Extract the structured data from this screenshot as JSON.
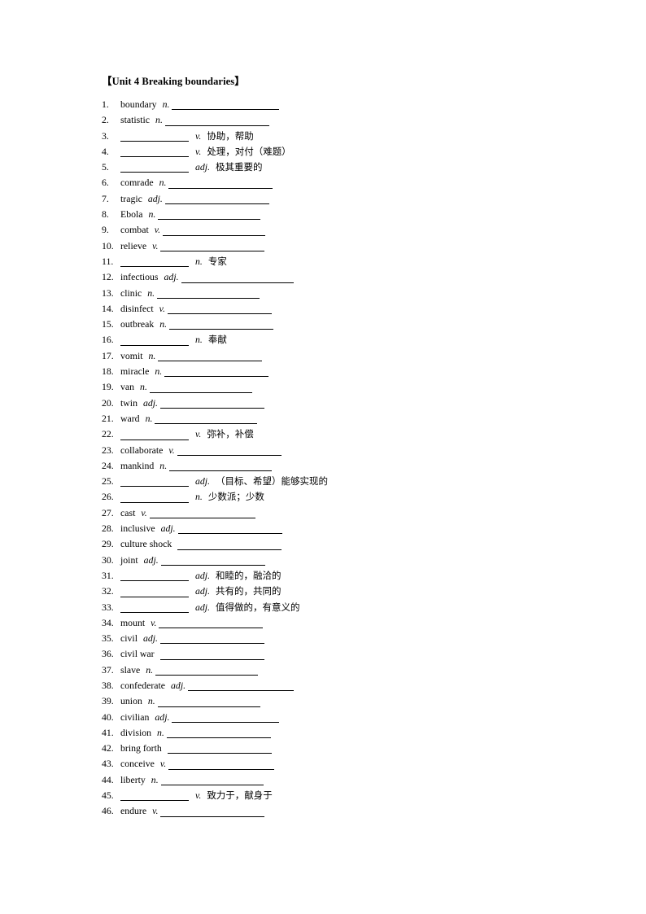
{
  "document": {
    "title": "【Unit 4 Breaking boundaries】",
    "title_bracket_open": "【",
    "title_bracket_close": "】",
    "title_text": "Unit 4 Breaking boundaries"
  },
  "vocabulary": {
    "columns": [
      "number",
      "term",
      "part_of_speech",
      "answer_blank",
      "meaning"
    ],
    "items": [
      {
        "num": "1.",
        "term": "boundary",
        "pos": "n.",
        "meaning": "",
        "blank_width": 132
      },
      {
        "num": "2.",
        "term": "statistic",
        "pos": "n.",
        "meaning": "",
        "blank_width": 128
      },
      {
        "num": "3.",
        "term": "",
        "pos": "v.",
        "meaning": "协助，帮助",
        "blank_width": 84
      },
      {
        "num": "4.",
        "term": "",
        "pos": "v.",
        "meaning": "处理，对付（难题）",
        "blank_width": 84
      },
      {
        "num": "5.",
        "term": "",
        "pos": "adj.",
        "meaning": "极其重要的",
        "blank_width": 84
      },
      {
        "num": "6.",
        "term": "comrade",
        "pos": "n.",
        "meaning": "",
        "blank_width": 128
      },
      {
        "num": "7.",
        "term": "tragic",
        "pos": "adj.",
        "meaning": "",
        "blank_width": 128
      },
      {
        "num": "8.",
        "term": "Ebola",
        "pos": "n.",
        "meaning": "",
        "blank_width": 126
      },
      {
        "num": "9.",
        "term": "combat",
        "pos": "v.",
        "meaning": "",
        "blank_width": 126
      },
      {
        "num": "10.",
        "term": "relieve",
        "pos": "v.",
        "meaning": "",
        "blank_width": 128
      },
      {
        "num": "11.",
        "term": "",
        "pos": "n.",
        "meaning": "专家",
        "blank_width": 84
      },
      {
        "num": "12.",
        "term": "infectious",
        "pos": "adj.",
        "meaning": "",
        "blank_width": 138
      },
      {
        "num": "13.",
        "term": "clinic",
        "pos": "n.",
        "meaning": "",
        "blank_width": 126
      },
      {
        "num": "14.",
        "term": "disinfect",
        "pos": "v.",
        "meaning": "",
        "blank_width": 128
      },
      {
        "num": "15.",
        "term": "outbreak",
        "pos": "n.",
        "meaning": "",
        "blank_width": 128
      },
      {
        "num": "16.",
        "term": "",
        "pos": "n.",
        "meaning": "奉献",
        "blank_width": 84
      },
      {
        "num": "17.",
        "term": "vomit",
        "pos": "n.",
        "meaning": "",
        "blank_width": 128
      },
      {
        "num": "18.",
        "term": "miracle",
        "pos": "n.",
        "meaning": "",
        "blank_width": 128
      },
      {
        "num": "19.",
        "term": "van",
        "pos": "n.",
        "meaning": "",
        "blank_width": 126
      },
      {
        "num": "20.",
        "term": "twin",
        "pos": "adj.",
        "meaning": "",
        "blank_width": 128
      },
      {
        "num": "21.",
        "term": "ward",
        "pos": "n.",
        "meaning": "",
        "blank_width": 126
      },
      {
        "num": "22.",
        "term": "",
        "pos": "v.",
        "meaning": "弥补，补偿",
        "blank_width": 84
      },
      {
        "num": "23.",
        "term": "collaborate",
        "pos": "v.",
        "meaning": "",
        "blank_width": 128
      },
      {
        "num": "24.",
        "term": "mankind",
        "pos": "n.",
        "meaning": "",
        "blank_width": 126
      },
      {
        "num": "25.",
        "term": "",
        "pos": "adj.",
        "meaning": "（目标、希望）能够实现的",
        "blank_width": 84
      },
      {
        "num": "26.",
        "term": "",
        "pos": "n.",
        "meaning": "少数派；少数",
        "blank_width": 84
      },
      {
        "num": "27.",
        "term": "cast",
        "pos": "v.",
        "meaning": "",
        "blank_width": 130
      },
      {
        "num": "28.",
        "term": "inclusive",
        "pos": "adj.",
        "meaning": "",
        "blank_width": 128
      },
      {
        "num": "29.",
        "term": "culture shock",
        "pos": "",
        "meaning": "",
        "blank_width": 128
      },
      {
        "num": "30.",
        "term": "joint",
        "pos": "adj.",
        "meaning": "",
        "blank_width": 128
      },
      {
        "num": "31.",
        "term": "",
        "pos": "adj.",
        "meaning": "和睦的，融洽的",
        "blank_width": 84
      },
      {
        "num": "32.",
        "term": "",
        "pos": "adj.",
        "meaning": "共有的，共同的",
        "blank_width": 84
      },
      {
        "num": "33.",
        "term": "",
        "pos": "adj.",
        "meaning": "值得做的，有意义的",
        "blank_width": 84
      },
      {
        "num": "34.",
        "term": "mount",
        "pos": "v.",
        "meaning": "",
        "blank_width": 128
      },
      {
        "num": "35.",
        "term": "civil",
        "pos": "adj.",
        "meaning": "",
        "blank_width": 128
      },
      {
        "num": "36.",
        "term": "civil war",
        "pos": "",
        "meaning": "",
        "blank_width": 128
      },
      {
        "num": "37.",
        "term": "slave",
        "pos": "n.",
        "meaning": "",
        "blank_width": 126
      },
      {
        "num": "38.",
        "term": "confederate",
        "pos": "adj.",
        "meaning": "",
        "blank_width": 130
      },
      {
        "num": "39.",
        "term": "union",
        "pos": "n.",
        "meaning": "",
        "blank_width": 126
      },
      {
        "num": "40.",
        "term": "civilian",
        "pos": "adj.",
        "meaning": "",
        "blank_width": 132
      },
      {
        "num": "41.",
        "term": "division",
        "pos": "n.",
        "meaning": "",
        "blank_width": 128
      },
      {
        "num": "42.",
        "term": "bring forth",
        "pos": "",
        "meaning": "",
        "blank_width": 128
      },
      {
        "num": "43.",
        "term": "conceive",
        "pos": "v.",
        "meaning": "",
        "blank_width": 130
      },
      {
        "num": "44.",
        "term": "liberty",
        "pos": "n.",
        "meaning": "",
        "blank_width": 126
      },
      {
        "num": "45.",
        "term": "",
        "pos": "v.",
        "meaning": "致力于，献身于",
        "blank_width": 84
      },
      {
        "num": "46.",
        "term": "endure",
        "pos": "v.",
        "meaning": "",
        "blank_width": 128
      }
    ]
  }
}
